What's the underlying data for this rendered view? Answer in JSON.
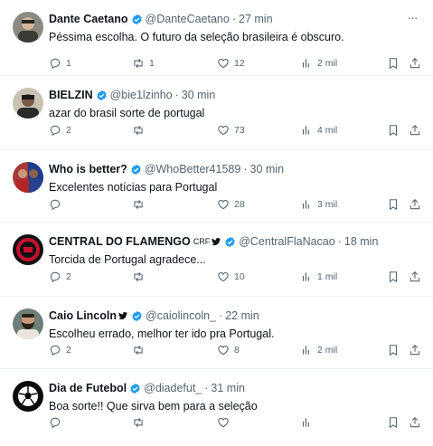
{
  "colors": {
    "verified": "#1d9bf0",
    "muted": "#536471",
    "text": "#0f1419",
    "divider": "#eff3f4"
  },
  "tweets": [
    {
      "name": "Dante Caetano",
      "verified": true,
      "handle": "@DanteCaetano",
      "sep": "·",
      "time": "27 min",
      "text": "Péssima escolha. O futuro da seleção brasileira é obscuro.",
      "replies": "1",
      "retweets": "1",
      "likes": "12",
      "views": "2 mil"
    },
    {
      "name": "BIELZIN",
      "verified": true,
      "handle": "@bie1lzinho",
      "sep": "·",
      "time": "30 min",
      "text": "azar do brasil sorte de portugal",
      "replies": "2",
      "retweets": "",
      "likes": "73",
      "views": "4 mil"
    },
    {
      "name": "Who is better?",
      "verified": true,
      "handle": "@WhoBetter41589",
      "sep": "·",
      "time": "30 min",
      "text": "Excelentes notícias para Portugal",
      "replies": "",
      "retweets": "",
      "likes": "28",
      "views": "3 mil"
    },
    {
      "name": "CENTRAL DO FLAMENGO",
      "affiliation": "CRF",
      "verified": true,
      "handle": "@CentralFlaNacao",
      "sep": "·",
      "time": "18 min",
      "text": "Torcida de Portugal agradece...",
      "replies": "2",
      "retweets": "",
      "likes": "10",
      "views": "1 mil"
    },
    {
      "name": "Caio Lincoln",
      "verified": true,
      "handle": "@caiolincoln_",
      "sep": "·",
      "time": "22 min",
      "text": "Escolheu errado, melhor ter ido pra Portugal.",
      "replies": "2",
      "retweets": "",
      "likes": "8",
      "views": "2 mil"
    },
    {
      "name": "Dia de Futebol",
      "verified": true,
      "handle": "@diadefut_",
      "sep": "·",
      "time": "31 min",
      "text": "Boa sorte!! Que sirva bem para a seleção",
      "replies": "",
      "retweets": "",
      "likes": "",
      "views": ""
    }
  ]
}
